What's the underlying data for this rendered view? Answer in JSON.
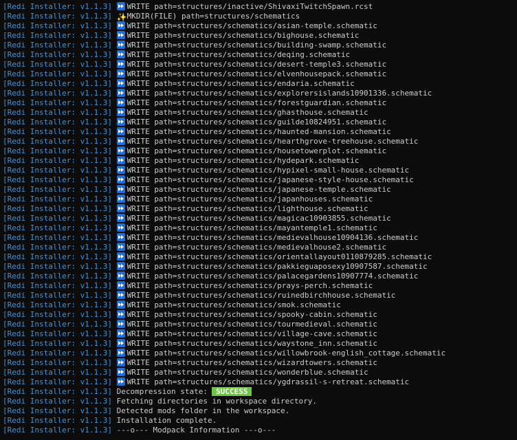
{
  "prefix": "[Redi Installer: v1.1.3]",
  "lines": [
    {
      "icon": "write-icon",
      "text": "WRITE path=structures/inactive/ShivaxiTwitchSpawn.rcst"
    },
    {
      "icon": "sparkle-icon",
      "text": "MKDIR(FILE) path=structures/schematics"
    },
    {
      "icon": "write-icon",
      "text": "WRITE path=structures/schematics/asian-temple.schematic"
    },
    {
      "icon": "write-icon",
      "text": "WRITE path=structures/schematics/bighouse.schematic"
    },
    {
      "icon": "write-icon",
      "text": "WRITE path=structures/schematics/building-swamp.schematic"
    },
    {
      "icon": "write-icon",
      "text": "WRITE path=structures/schematics/deqing.schematic"
    },
    {
      "icon": "write-icon",
      "text": "WRITE path=structures/schematics/desert-temple3.schematic"
    },
    {
      "icon": "write-icon",
      "text": "WRITE path=structures/schematics/elvenhousepack.schematic"
    },
    {
      "icon": "write-icon",
      "text": "WRITE path=structures/schematics/endaria.schematic"
    },
    {
      "icon": "write-icon",
      "text": "WRITE path=structures/schematics/explorersislands10901336.schematic"
    },
    {
      "icon": "write-icon",
      "text": "WRITE path=structures/schematics/forestguardian.schematic"
    },
    {
      "icon": "write-icon",
      "text": "WRITE path=structures/schematics/ghasthouse.schematic"
    },
    {
      "icon": "write-icon",
      "text": "WRITE path=structures/schematics/guilde10824951.schematic"
    },
    {
      "icon": "write-icon",
      "text": "WRITE path=structures/schematics/haunted-mansion.schematic"
    },
    {
      "icon": "write-icon",
      "text": "WRITE path=structures/schematics/hearthgrove-treehouse.schematic"
    },
    {
      "icon": "write-icon",
      "text": "WRITE path=structures/schematics/housetowerplot.schematic"
    },
    {
      "icon": "write-icon",
      "text": "WRITE path=structures/schematics/hydepark.schematic"
    },
    {
      "icon": "write-icon",
      "text": "WRITE path=structures/schematics/hypixel-small-house.schematic"
    },
    {
      "icon": "write-icon",
      "text": "WRITE path=structures/schematics/japanese-style-house.schematic"
    },
    {
      "icon": "write-icon",
      "text": "WRITE path=structures/schematics/japanese-temple.schematic"
    },
    {
      "icon": "write-icon",
      "text": "WRITE path=structures/schematics/japanhouses.schematic"
    },
    {
      "icon": "write-icon",
      "text": "WRITE path=structures/schematics/lighthouse.schematic"
    },
    {
      "icon": "write-icon",
      "text": "WRITE path=structures/schematics/magicac10903855.schematic"
    },
    {
      "icon": "write-icon",
      "text": "WRITE path=structures/schematics/mayantemple1.schematic"
    },
    {
      "icon": "write-icon",
      "text": "WRITE path=structures/schematics/medievalhouse10904136.schematic"
    },
    {
      "icon": "write-icon",
      "text": "WRITE path=structures/schematics/medievalhouse2.schematic"
    },
    {
      "icon": "write-icon",
      "text": "WRITE path=structures/schematics/orientallayout0110879285.schematic"
    },
    {
      "icon": "write-icon",
      "text": "WRITE path=structures/schematics/pakkieguaposexy10907587.schematic"
    },
    {
      "icon": "write-icon",
      "text": "WRITE path=structures/schematics/palacegardens10907774.schematic"
    },
    {
      "icon": "write-icon",
      "text": "WRITE path=structures/schematics/prays-perch.schematic"
    },
    {
      "icon": "write-icon",
      "text": "WRITE path=structures/schematics/ruinedbirchhouse.schematic"
    },
    {
      "icon": "write-icon",
      "text": "WRITE path=structures/schematics/smok.schematic"
    },
    {
      "icon": "write-icon",
      "text": "WRITE path=structures/schematics/spooky-cabin.schematic"
    },
    {
      "icon": "write-icon",
      "text": "WRITE path=structures/schematics/tourmedieval.schematic"
    },
    {
      "icon": "write-icon",
      "text": "WRITE path=structures/schematics/village-cave.schematic"
    },
    {
      "icon": "write-icon",
      "text": "WRITE path=structures/schematics/waystone_inn.schematic"
    },
    {
      "icon": "write-icon",
      "text": "WRITE path=structures/schematics/willowbrook-english_cottage.schematic"
    },
    {
      "icon": "write-icon",
      "text": "WRITE path=structures/schematics/wizardtowers.schematic"
    },
    {
      "icon": "write-icon",
      "text": "WRITE path=structures/schematics/wonderblue.schematic"
    },
    {
      "icon": "write-icon",
      "text": "WRITE path=structures/schematics/ygdrassil-s-retreat.schematic"
    },
    {
      "text": "Decompression state:",
      "badge": "SUCCESS"
    },
    {
      "text": "Fetching directories in workspace directory."
    },
    {
      "text": "Detected mods folder in the workspace."
    },
    {
      "text": "Installation complete."
    },
    {
      "text": "---o--- Modpack Information ---o---"
    }
  ],
  "colors": {
    "background": "#0c0c0c",
    "prefix": "#3a96dd",
    "text": "#cccccc",
    "badge": "#6cc644"
  }
}
